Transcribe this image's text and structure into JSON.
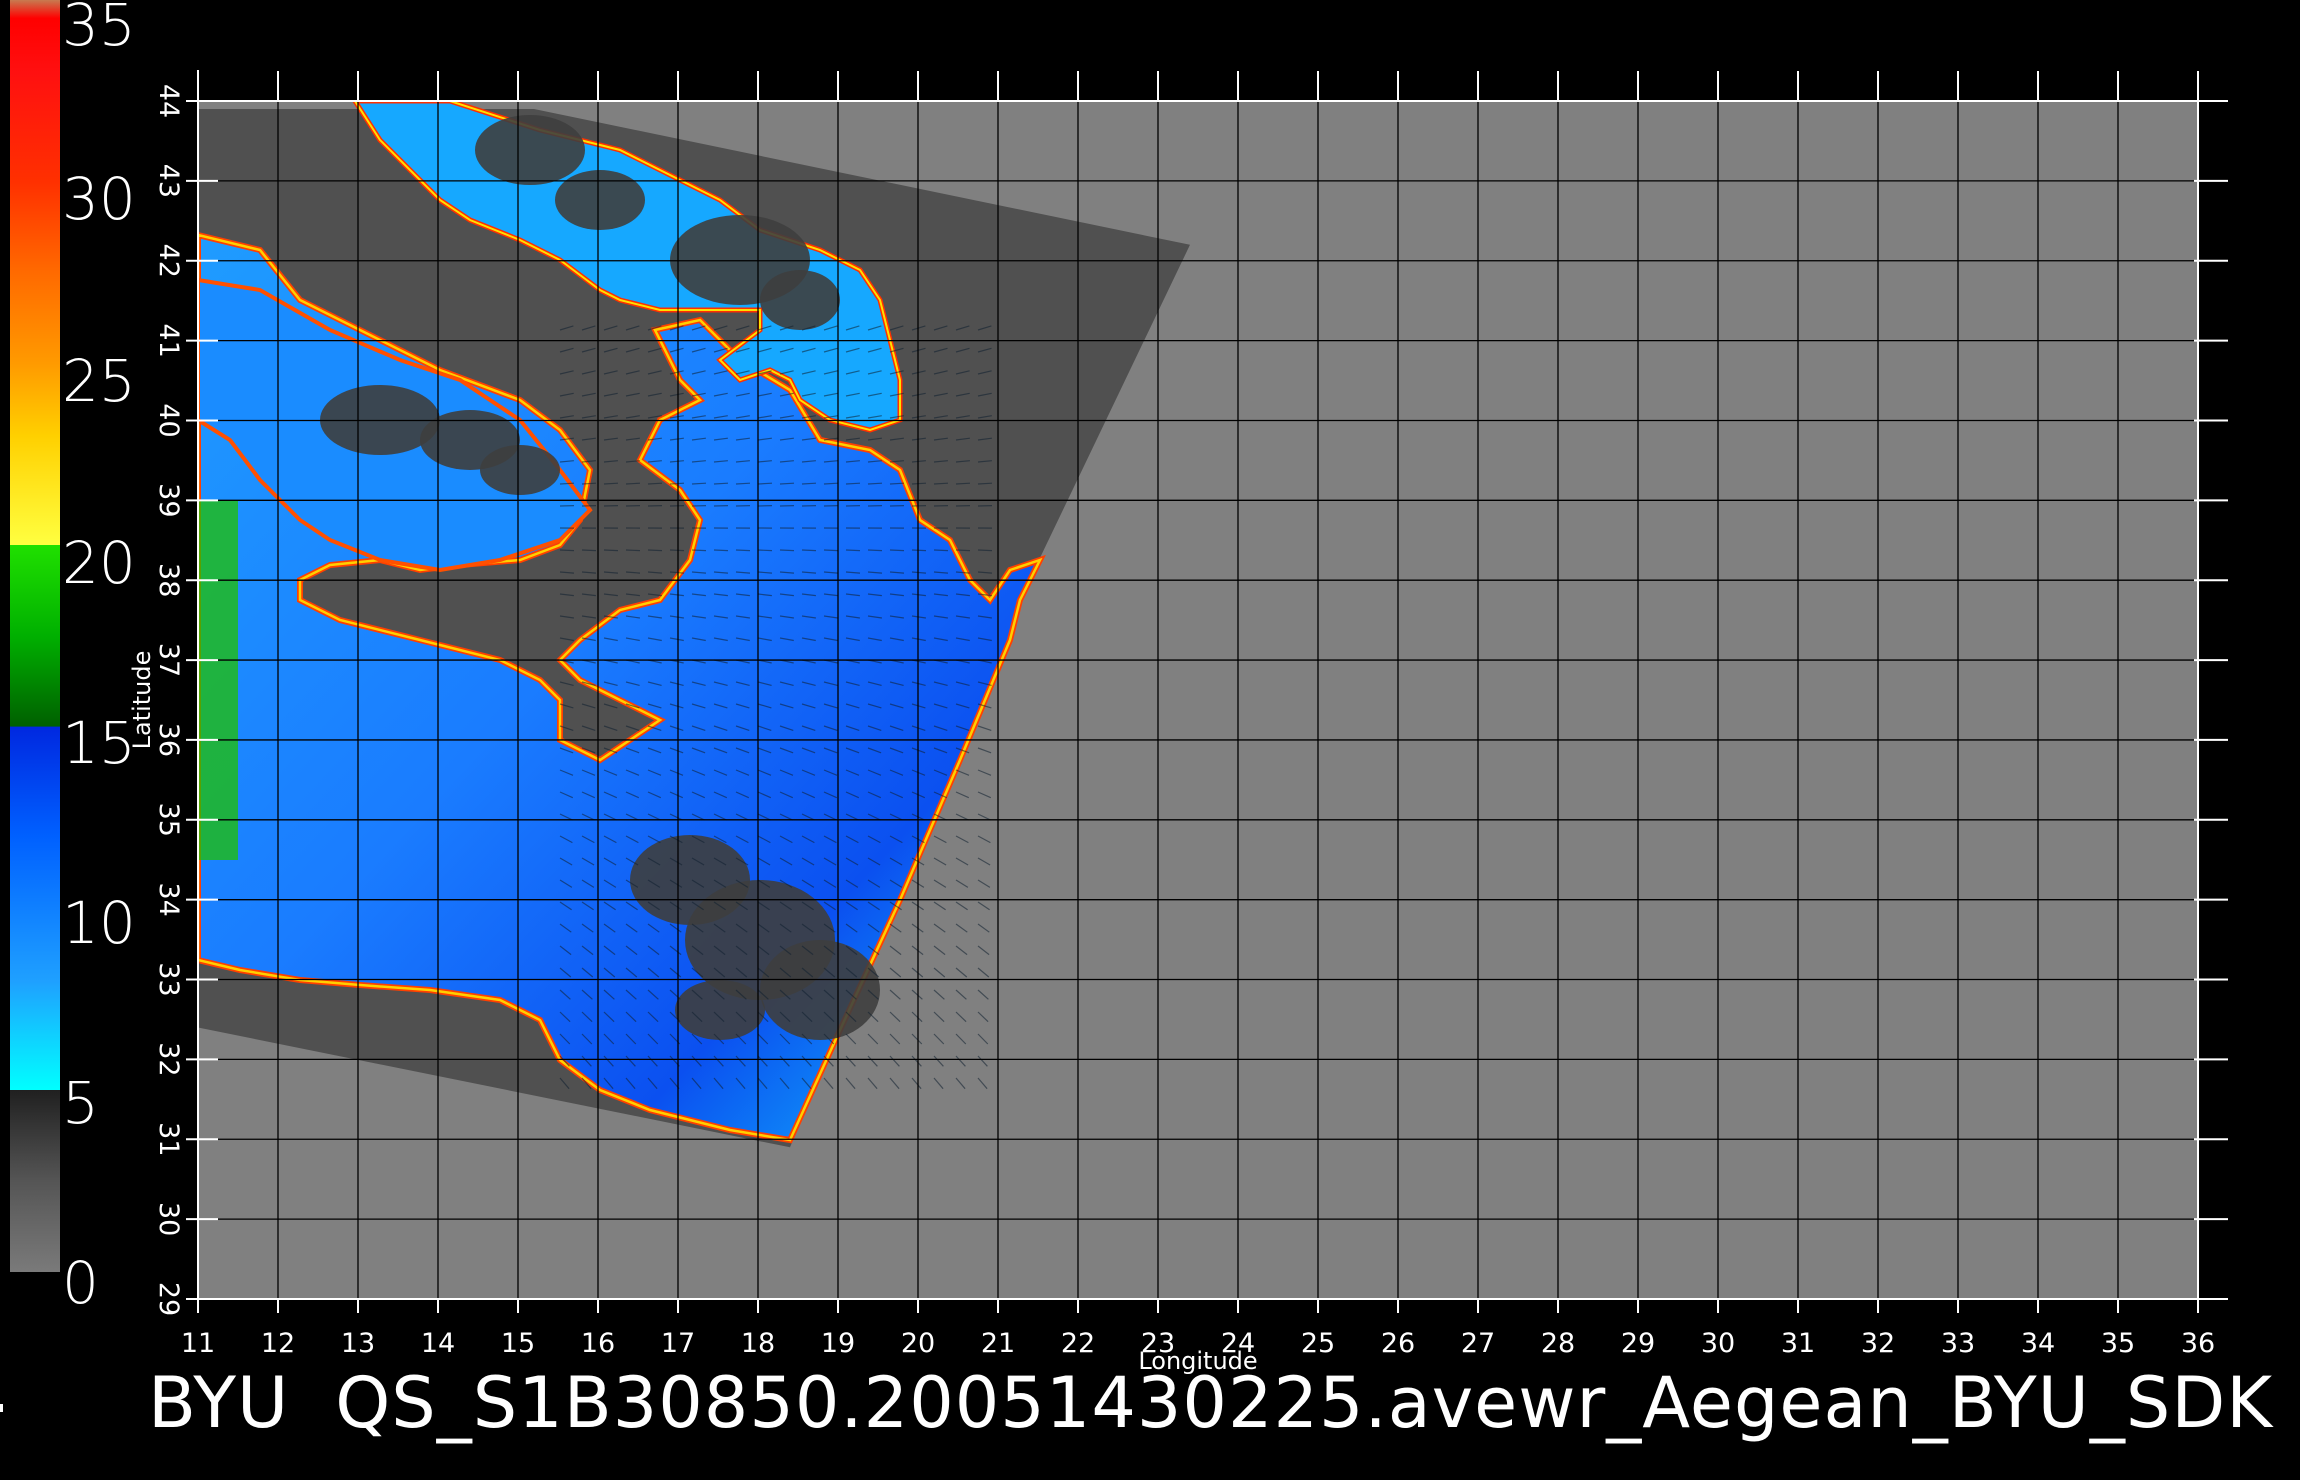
{
  "colors": {
    "background": "#000000",
    "land": "#808080",
    "swath": "#505050",
    "grid": "#000000",
    "text": "#ffffff"
  },
  "colorbar": {
    "labels": [
      "35",
      "30",
      "25",
      "20",
      "15",
      "10",
      "5",
      "0"
    ],
    "stops": [
      {
        "value": 0,
        "color": "#7a7a7a"
      },
      {
        "value": 2.5,
        "color": "#555555"
      },
      {
        "value": 5,
        "color": "#202020"
      },
      {
        "value": 5.01,
        "color": "#00ffff"
      },
      {
        "value": 8,
        "color": "#1fa0ff"
      },
      {
        "value": 12,
        "color": "#0060ff"
      },
      {
        "value": 15,
        "color": "#0028e0"
      },
      {
        "value": 15.01,
        "color": "#006000"
      },
      {
        "value": 17.5,
        "color": "#00b000"
      },
      {
        "value": 20,
        "color": "#20e000"
      },
      {
        "value": 20.01,
        "color": "#ffff40"
      },
      {
        "value": 23,
        "color": "#ffd000"
      },
      {
        "value": 25,
        "color": "#ff9a00"
      },
      {
        "value": 27.5,
        "color": "#ff6a00"
      },
      {
        "value": 30,
        "color": "#ff3000"
      },
      {
        "value": 33,
        "color": "#ff1010"
      },
      {
        "value": 34.5,
        "color": "#ff0000"
      },
      {
        "value": 35,
        "color": "#c87a50"
      }
    ]
  },
  "map": {
    "lon_range": [
      11,
      36
    ],
    "lat_range": [
      29,
      44
    ],
    "lon_ticks": [
      "11",
      "12",
      "13",
      "14",
      "15",
      "16",
      "17",
      "18",
      "19",
      "20",
      "21",
      "22",
      "23",
      "24",
      "25",
      "26",
      "27",
      "28",
      "29",
      "30",
      "31",
      "32",
      "33",
      "34",
      "35",
      "36"
    ],
    "lat_ticks": [
      "29",
      "30",
      "31",
      "32",
      "33",
      "34",
      "35",
      "36",
      "37",
      "38",
      "39",
      "40",
      "41",
      "42",
      "43",
      "44"
    ],
    "xlabel": "Longitude",
    "ylabel": "Latitude",
    "swath_corners": [
      [
        11,
        43.9
      ],
      [
        15.2,
        43.9
      ],
      [
        23.4,
        42.2
      ],
      [
        21.2,
        37.6
      ],
      [
        18.4,
        30.9
      ],
      [
        11,
        32.4
      ]
    ]
  },
  "caption": {
    "left": "BYU",
    "right": "QS_S1B30850.20051430225.avewr_Aegean_BYU_SDK"
  }
}
